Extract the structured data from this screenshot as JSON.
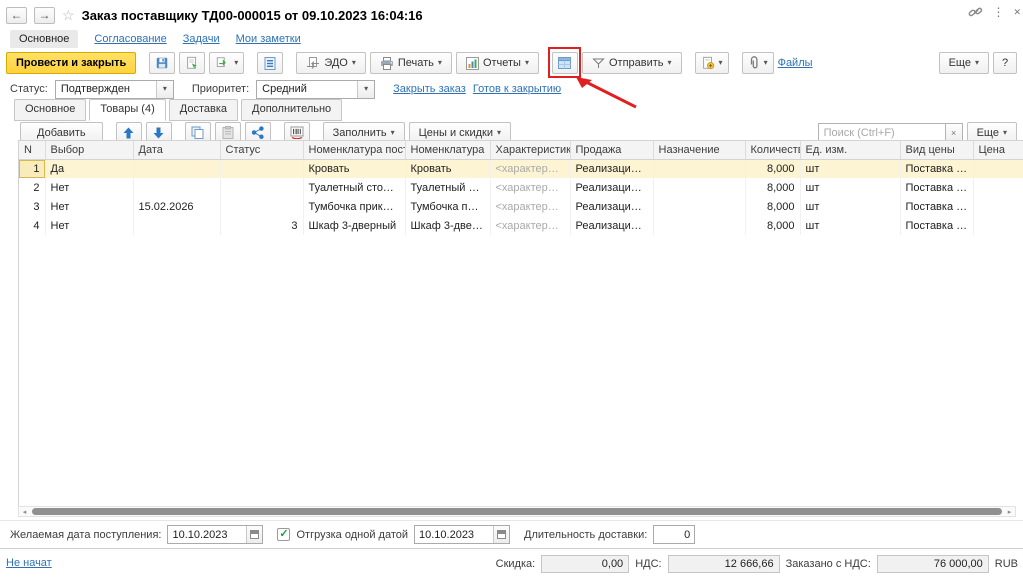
{
  "colors": {
    "accent_yellow": "#ffd23e",
    "annotation_red": "#e02020",
    "link_blue": "#2e71b5",
    "selected_row": "#fcf4d2"
  },
  "icons": {
    "back": "←",
    "forward": "→",
    "star": "☆",
    "menu": "⋮",
    "close": "✕",
    "caret": "▾",
    "clear": "×",
    "check": "✓",
    "scroll_left": "◂",
    "scroll_right": "▸"
  },
  "header": {
    "title": "Заказ поставщику ТД00-000015 от 09.10.2023 16:04:16",
    "nav_tabs": [
      "Основное",
      "Согласование",
      "Задачи",
      "Мои заметки"
    ]
  },
  "toolbar": {
    "post_close": "Провести и закрыть",
    "edo": "ЭДО",
    "print": "Печать",
    "reports": "Отчеты",
    "send": "Отправить",
    "files": "Файлы",
    "more": "Еще",
    "help": "?"
  },
  "status_row": {
    "status_label": "Статус:",
    "status_value": "Подтвержден",
    "priority_label": "Приоритет:",
    "priority_value": "Средний",
    "close_order_link": "Закрыть заказ",
    "ready_link": "Готов к закрытию"
  },
  "tabs": {
    "main": "Основное",
    "goods": "Товары (4)",
    "delivery": "Доставка",
    "extra": "Дополнительно"
  },
  "table_toolbar": {
    "add": "Добавить",
    "fill": "Заполнить",
    "prices": "Цены и скидки",
    "search_placeholder": "Поиск (Ctrl+F)",
    "more": "Еще"
  },
  "table": {
    "columns": [
      "N",
      "Выбор",
      "Дата",
      "Статус",
      "Номенклатура поставщика",
      "Номенклатура",
      "Характеристика",
      "Продажа",
      "Назначение",
      "Количество",
      "Ед. изм.",
      "Вид цены",
      "Цена"
    ],
    "rows": [
      {
        "n": "1",
        "choice": "Да",
        "date": "",
        "status": "",
        "supplier_item": "Кровать",
        "item": "Кровать",
        "characteristic": "<характеристики…",
        "sale": "Реализация товар…",
        "purpose": "",
        "qty": "8,000",
        "unit": "шт",
        "price_kind": "Поставка мебели",
        "price": ""
      },
      {
        "n": "2",
        "choice": "Нет",
        "date": "",
        "status": "",
        "supplier_item": "Туалетный столик",
        "item": "Туалетный столик",
        "characteristic": "<характеристики…",
        "sale": "Реализация товар…",
        "purpose": "",
        "qty": "8,000",
        "unit": "шт",
        "price_kind": "Поставка мебели",
        "price": ""
      },
      {
        "n": "3",
        "choice": "Нет",
        "date": "15.02.2026",
        "status": "",
        "supplier_item": "Тумбочка прикроватная",
        "item": "Тумбочка прикро…",
        "characteristic": "<характеристики…",
        "sale": "Реализация товар…",
        "purpose": "",
        "qty": "8,000",
        "unit": "шт",
        "price_kind": "Поставка мебели",
        "price": ""
      },
      {
        "n": "4",
        "choice": "Нет",
        "date": "",
        "status": "3",
        "supplier_item": "Шкаф 3-дверный",
        "item": "Шкаф 3-дверный",
        "characteristic": "<характеристики…",
        "sale": "Реализация товар…",
        "purpose": "",
        "qty": "8,000",
        "unit": "шт",
        "price_kind": "Поставка мебели",
        "price": ""
      }
    ]
  },
  "footer_fields": {
    "desired_date_label": "Желаемая дата поступления:",
    "desired_date": "10.10.2023",
    "single_date_label": "Отгрузка одной датой",
    "ship_date": "10.10.2023",
    "duration_label": "Длительность доставки:",
    "duration": "0"
  },
  "status_bar": {
    "state_link": "Не начат",
    "discount_label": "Скидка:",
    "discount": "0,00",
    "vat_label": "НДС:",
    "vat": "12 666,66",
    "ordered_label": "Заказано с НДС:",
    "ordered": "76 000,00",
    "currency": "RUB"
  }
}
